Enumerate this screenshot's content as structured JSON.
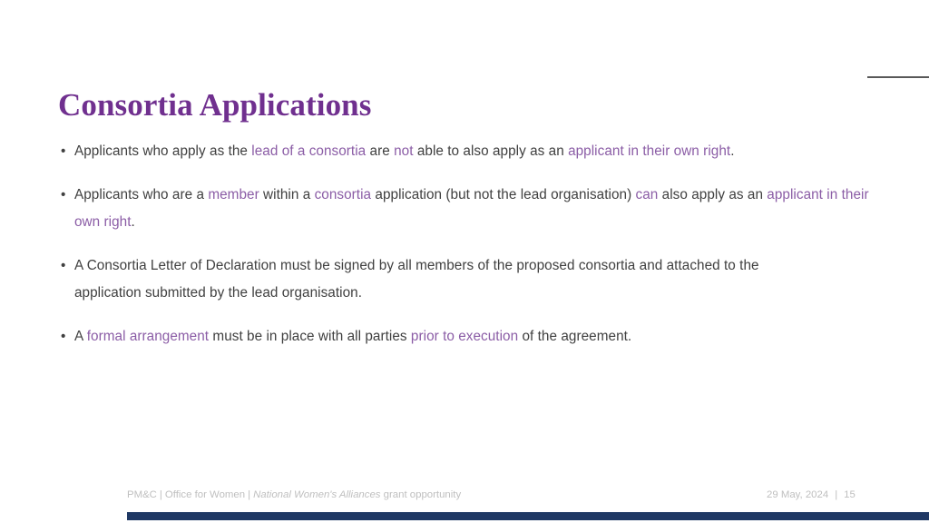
{
  "slide": {
    "title": "Consortia Applications",
    "bullets": [
      {
        "marker": "•",
        "segments": [
          {
            "text": "Applicants who apply as the ",
            "style": "plain"
          },
          {
            "text": "lead of a consortia",
            "style": "highlight"
          },
          {
            "text": " are ",
            "style": "plain"
          },
          {
            "text": "not",
            "style": "highlight"
          },
          {
            "text": " able to also apply as an ",
            "style": "plain"
          },
          {
            "text": "applicant in their own right",
            "style": "highlight"
          },
          {
            "text": ".",
            "style": "plain"
          }
        ]
      },
      {
        "marker": "•",
        "segments": [
          {
            "text": "Applicants who are a ",
            "style": "plain"
          },
          {
            "text": "member",
            "style": "highlight"
          },
          {
            "text": " within a ",
            "style": "plain"
          },
          {
            "text": "consortia",
            "style": "highlight"
          },
          {
            "text": " application (but not the lead organisation) ",
            "style": "plain"
          },
          {
            "text": "can",
            "style": "highlight"
          },
          {
            "text": " also apply as an ",
            "style": "plain"
          },
          {
            "text": "applicant in their own right",
            "style": "highlight"
          },
          {
            "text": ".",
            "style": "plain"
          }
        ]
      },
      {
        "marker": "•",
        "segments": [
          {
            "text": "A Consortia Letter of Declaration must be signed by all members of the proposed consortia and attached to the application submitted by the lead organisation.",
            "style": "plain"
          }
        ]
      },
      {
        "marker": "•",
        "segments": [
          {
            "text": "A ",
            "style": "plain"
          },
          {
            "text": "formal arrangement",
            "style": "highlight"
          },
          {
            "text": " must be in place with all parties ",
            "style": "plain"
          },
          {
            "text": "prior to execution",
            "style": "highlight"
          },
          {
            "text": " of the agreement.",
            "style": "plain"
          }
        ]
      }
    ]
  },
  "footer": {
    "org": "PM&C",
    "separator": "|",
    "department": "Office for Women",
    "program_italic": "National Women's Alliances",
    "program_rest": " grant opportunity",
    "date": "29 May, 2024",
    "page_number": "15"
  },
  "colors": {
    "title_purple": "#70308F",
    "highlight_purple": "#8B5DA6",
    "body_gray": "#404040",
    "footer_gray": "#BFBFBF",
    "bottom_bar_navy": "#1F3864",
    "top_rule_gray": "#595959",
    "background": "#FFFFFF"
  }
}
